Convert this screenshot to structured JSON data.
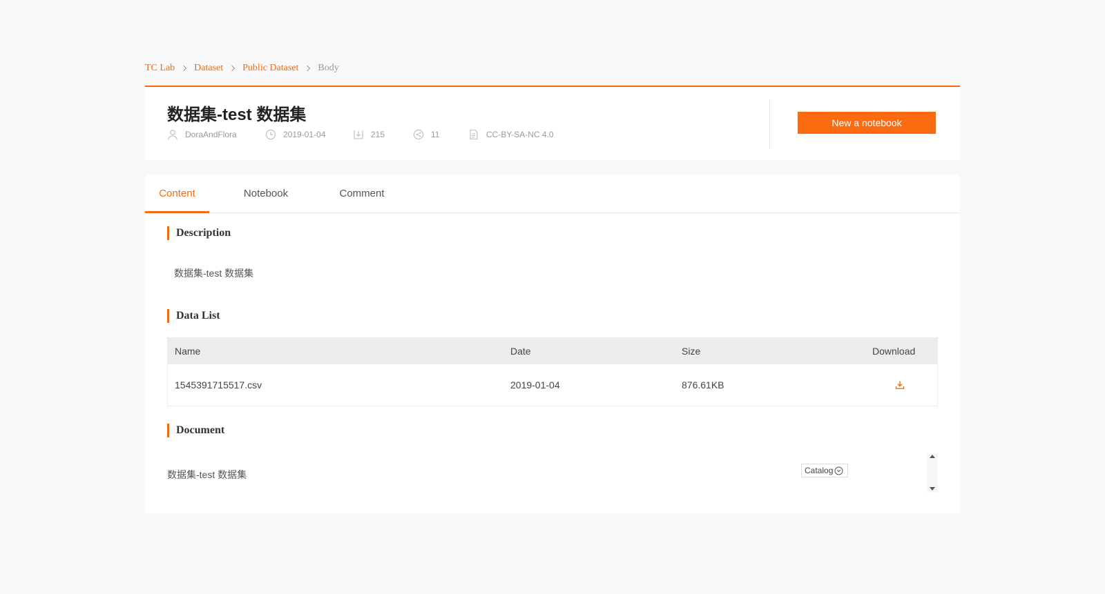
{
  "colors": {
    "accent": "#f46b11",
    "button": "#fc6b10",
    "muted": "#999999"
  },
  "breadcrumb": [
    {
      "label": "TC Lab"
    },
    {
      "label": "Dataset"
    },
    {
      "label": "Public Dataset"
    },
    {
      "label": "Body"
    }
  ],
  "dataset": {
    "title": "数据集-test 数据集",
    "author": "DoraAndFlora",
    "date": "2019-01-04",
    "downloads": "215",
    "shares": "11",
    "license": "CC-BY-SA-NC 4.0",
    "icons": {
      "author": "user-icon",
      "date": "clock-icon",
      "downloads": "download-count-icon",
      "shares": "share-icon",
      "license": "document-icon"
    }
  },
  "actions": {
    "new_notebook": "New a notebook"
  },
  "tabs": [
    {
      "label": "Content",
      "active": true
    },
    {
      "label": "Notebook",
      "active": false
    },
    {
      "label": "Comment",
      "active": false
    }
  ],
  "description": {
    "title": "Description",
    "text": "数据集-test 数据集"
  },
  "data_list": {
    "title": "Data List",
    "columns": [
      "Name",
      "Date",
      "Size",
      "Download"
    ],
    "rows": [
      {
        "name": "1545391715517.csv",
        "date": "2019-01-04",
        "size": "876.61KB",
        "download_icon": "download-icon"
      }
    ]
  },
  "document": {
    "title": "Document",
    "text": "数据集-test 数据集",
    "catalog_label": "Catalog",
    "catalog_icon": "chevron-circle-icon"
  }
}
